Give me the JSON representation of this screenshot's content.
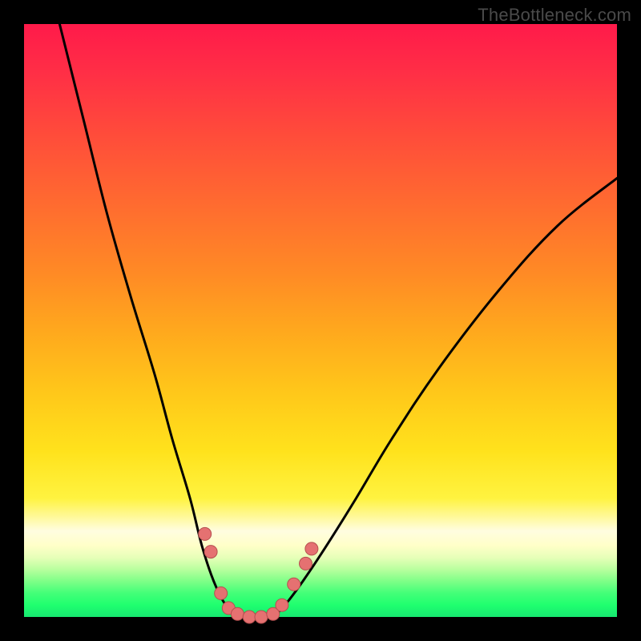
{
  "attribution": "TheBottleneck.com",
  "chart_data": {
    "type": "line",
    "title": "",
    "xlabel": "",
    "ylabel": "",
    "xlim": [
      0,
      100
    ],
    "ylim": [
      0,
      100
    ],
    "background_gradient_stops": [
      {
        "pct": 0,
        "hex": "#ff1a4a"
      },
      {
        "pct": 30,
        "hex": "#ff6a30"
      },
      {
        "pct": 62,
        "hex": "#ffc71a"
      },
      {
        "pct": 85,
        "hex": "#fffde0"
      },
      {
        "pct": 100,
        "hex": "#17e770"
      }
    ],
    "series": [
      {
        "name": "left-branch",
        "points": [
          {
            "x": 6,
            "y": 100
          },
          {
            "x": 10,
            "y": 84
          },
          {
            "x": 14,
            "y": 68
          },
          {
            "x": 18,
            "y": 54
          },
          {
            "x": 22,
            "y": 41
          },
          {
            "x": 25,
            "y": 30
          },
          {
            "x": 28,
            "y": 20
          },
          {
            "x": 30,
            "y": 12
          },
          {
            "x": 32,
            "y": 6
          },
          {
            "x": 34,
            "y": 2
          },
          {
            "x": 36,
            "y": 0
          }
        ]
      },
      {
        "name": "right-branch",
        "points": [
          {
            "x": 42,
            "y": 0
          },
          {
            "x": 44,
            "y": 2
          },
          {
            "x": 47,
            "y": 6
          },
          {
            "x": 51,
            "y": 12
          },
          {
            "x": 56,
            "y": 20
          },
          {
            "x": 62,
            "y": 30
          },
          {
            "x": 70,
            "y": 42
          },
          {
            "x": 80,
            "y": 55
          },
          {
            "x": 90,
            "y": 66
          },
          {
            "x": 100,
            "y": 74
          }
        ]
      }
    ],
    "markers": [
      {
        "x": 30.5,
        "y": 14
      },
      {
        "x": 31.5,
        "y": 11
      },
      {
        "x": 33.2,
        "y": 4
      },
      {
        "x": 34.5,
        "y": 1.5
      },
      {
        "x": 36.0,
        "y": 0.5
      },
      {
        "x": 38.0,
        "y": 0
      },
      {
        "x": 40.0,
        "y": 0
      },
      {
        "x": 42.0,
        "y": 0.5
      },
      {
        "x": 43.5,
        "y": 2
      },
      {
        "x": 45.5,
        "y": 5.5
      },
      {
        "x": 47.5,
        "y": 9
      },
      {
        "x": 48.5,
        "y": 11.5
      }
    ],
    "marker_radius": 8
  }
}
